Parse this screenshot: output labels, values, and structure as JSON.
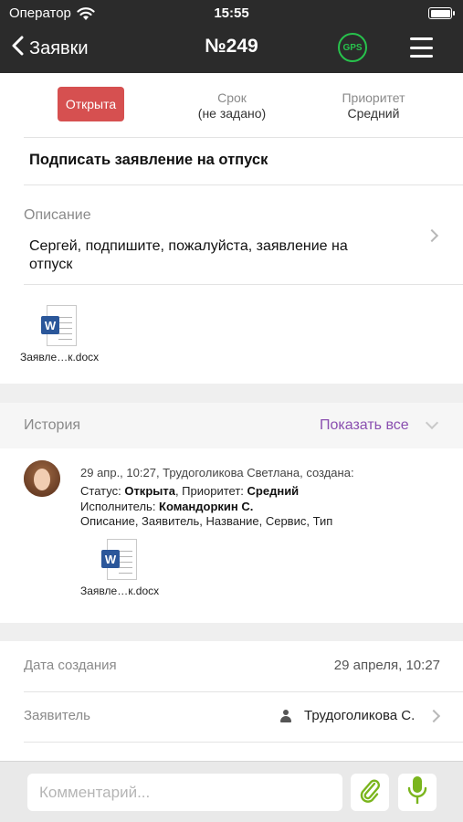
{
  "status_bar": {
    "carrier": "Оператор",
    "time": "15:55"
  },
  "nav": {
    "back_label": "Заявки",
    "title": "№249",
    "gps_label": "GPS"
  },
  "ticket": {
    "status": "Открыта",
    "deadline_label": "Срок",
    "deadline_value": "(не задано)",
    "priority_label": "Приоритет",
    "priority_value": "Средний",
    "title": "Подписать заявление на отпуск",
    "description_label": "Описание",
    "description_text": "Сергей, подпишите, пожалуйста, заявление на отпуск",
    "attachment_name": "Заявле…к.docx"
  },
  "history": {
    "label": "История",
    "show_all": "Показать все",
    "entry": {
      "header": "29 апр., 10:27, Трудоголикова Светлана, создана:",
      "status_prefix": "Статус: ",
      "status_value": "Открыта",
      "priority_prefix": ", Приоритет: ",
      "priority_value": "Средний",
      "assignee_prefix": "Исполнитель: ",
      "assignee_value": "Командоркин С.",
      "fields_changed": "Описание, Заявитель, Название, Сервис, Тип",
      "attachment_name": "Заявле…к.docx"
    }
  },
  "details": {
    "created_label": "Дата создания",
    "created_value": "29 апреля, 10:27",
    "applicant_label": "Заявитель",
    "applicant_value": "Трудоголикова С."
  },
  "comment_bar": {
    "placeholder": "Комментарий..."
  },
  "colors": {
    "header_bg": "#2b2b2b",
    "status_open": "#d65050",
    "gps_green": "#27c24c",
    "show_all_purple": "#8a4fb0",
    "mic_green": "#7ab51d",
    "word_blue": "#2b579a"
  },
  "icons": {
    "wifi": "wifi-icon",
    "battery": "battery-icon",
    "back": "chevron-left-icon",
    "menu": "hamburger-icon",
    "attachment": "docx-file-icon",
    "user": "user-icon",
    "paperclip": "paperclip-icon",
    "microphone": "microphone-icon"
  }
}
